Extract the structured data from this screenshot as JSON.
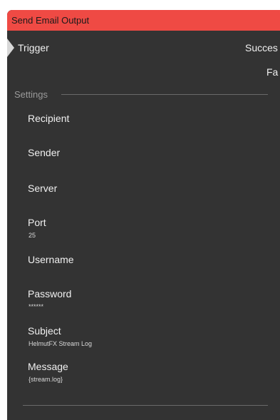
{
  "node": {
    "title": "Send Email Output",
    "trigger_label": "Trigger",
    "outputs": {
      "success_label": "Succes",
      "fail_label": "Fa"
    },
    "settings_label": "Settings",
    "fields": [
      {
        "label": "Recipient",
        "value": ""
      },
      {
        "label": "Sender",
        "value": ""
      },
      {
        "label": "Server",
        "value": ""
      },
      {
        "label": "Port",
        "value": "25"
      },
      {
        "label": "Username",
        "value": ""
      },
      {
        "label": "Password",
        "value": "******"
      },
      {
        "label": "Subject",
        "value": "HelmutFX Stream Log"
      },
      {
        "label": "Message",
        "value": "{stream.log}"
      }
    ]
  },
  "colors": {
    "title_bar": "#ef4a44",
    "panel": "#333333"
  }
}
